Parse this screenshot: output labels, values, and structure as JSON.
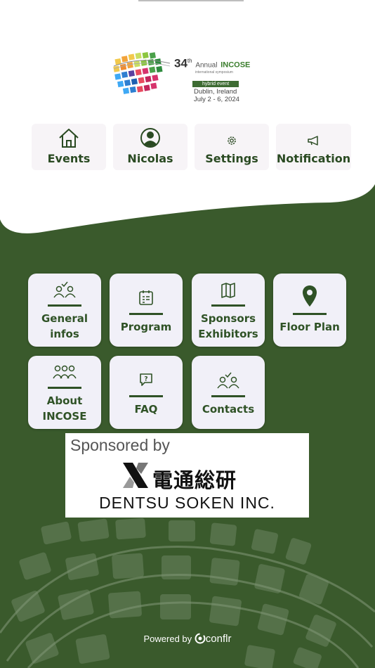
{
  "header": {
    "logo": {
      "edition": "34",
      "edition_suffix": "th",
      "annual": "Annual",
      "org": "INCOSE",
      "symposium": "international symposium",
      "hybrid": "hybrid event",
      "place": "Dublin, Ireland",
      "dates": "July 2 - 6, 2024"
    }
  },
  "quick_nav": [
    {
      "label": "Events",
      "icon": "home-icon"
    },
    {
      "label": "Nicolas",
      "icon": "user-icon"
    },
    {
      "label": "Settings",
      "icon": "gear-icon"
    },
    {
      "label": "Notification",
      "icon": "megaphone-icon"
    }
  ],
  "menu": [
    {
      "label": "General infos",
      "line1": "General",
      "line2": "infos",
      "icon": "people-check-icon"
    },
    {
      "label": "Program",
      "icon": "calendar-icon"
    },
    {
      "label": "Sponsors Exhibitors",
      "line1": "Sponsors",
      "line2": "Exhibitors",
      "icon": "map-icon"
    },
    {
      "label": "Floor Plan",
      "icon": "location-pin-icon"
    },
    {
      "label": "About INCOSE",
      "line1": "About",
      "line2": "INCOSE",
      "icon": "group-icon"
    },
    {
      "label": "FAQ",
      "icon": "question-bubble-icon"
    },
    {
      "label": "Contacts",
      "icon": "contacts-icon"
    }
  ],
  "sponsor": {
    "title": "Sponsored by",
    "kanji": "電通総研",
    "name": "DENTSU SOKEN INC."
  },
  "footer": {
    "powered_label": "Powered by",
    "brand": "conflr"
  },
  "colors": {
    "primary_green": "#3a5a2c",
    "button_bg": "#f1f0f8",
    "nav_bg": "#f7f4f7"
  }
}
